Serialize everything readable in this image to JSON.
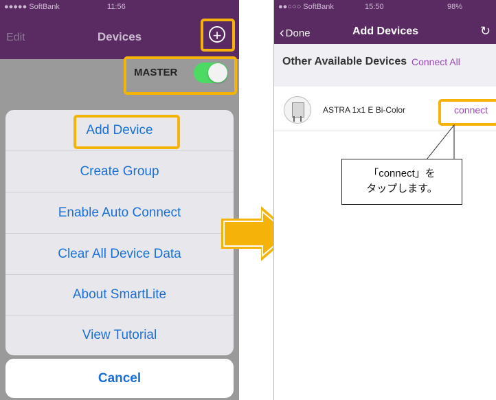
{
  "left_screen": {
    "status": {
      "carrier": "●●●●● SoftBank",
      "time": "11:56"
    },
    "nav": {
      "edit": "Edit",
      "title": "Devices",
      "add_icon": "plus-circle-icon"
    },
    "master_label": "MASTER",
    "master_toggle_on": true,
    "action_sheet": {
      "items": [
        "Add Device",
        "Create Group",
        "Enable Auto Connect",
        "Clear All Device Data",
        "About SmartLite",
        "View Tutorial"
      ],
      "cancel": "Cancel"
    }
  },
  "right_screen": {
    "status": {
      "carrier": "●●○○○ SoftBank",
      "time": "15:50",
      "battery": "98%"
    },
    "nav": {
      "back": "Done",
      "title": "Add Devices",
      "refresh_icon": "refresh-icon"
    },
    "section_title": "Other Available Devices",
    "connect_all": "Connect All",
    "devices": [
      {
        "name": "ASTRA 1x1 E Bi-Color",
        "action": "connect"
      }
    ]
  },
  "callout": {
    "line1": "「connect」を",
    "line2": "タップします。"
  },
  "colors": {
    "nav": "#5a2a63",
    "highlight": "#f5b30a",
    "ios_blue": "#1a6fd6",
    "accent_purple": "#9a48b8",
    "toggle_green": "#4cd964"
  }
}
